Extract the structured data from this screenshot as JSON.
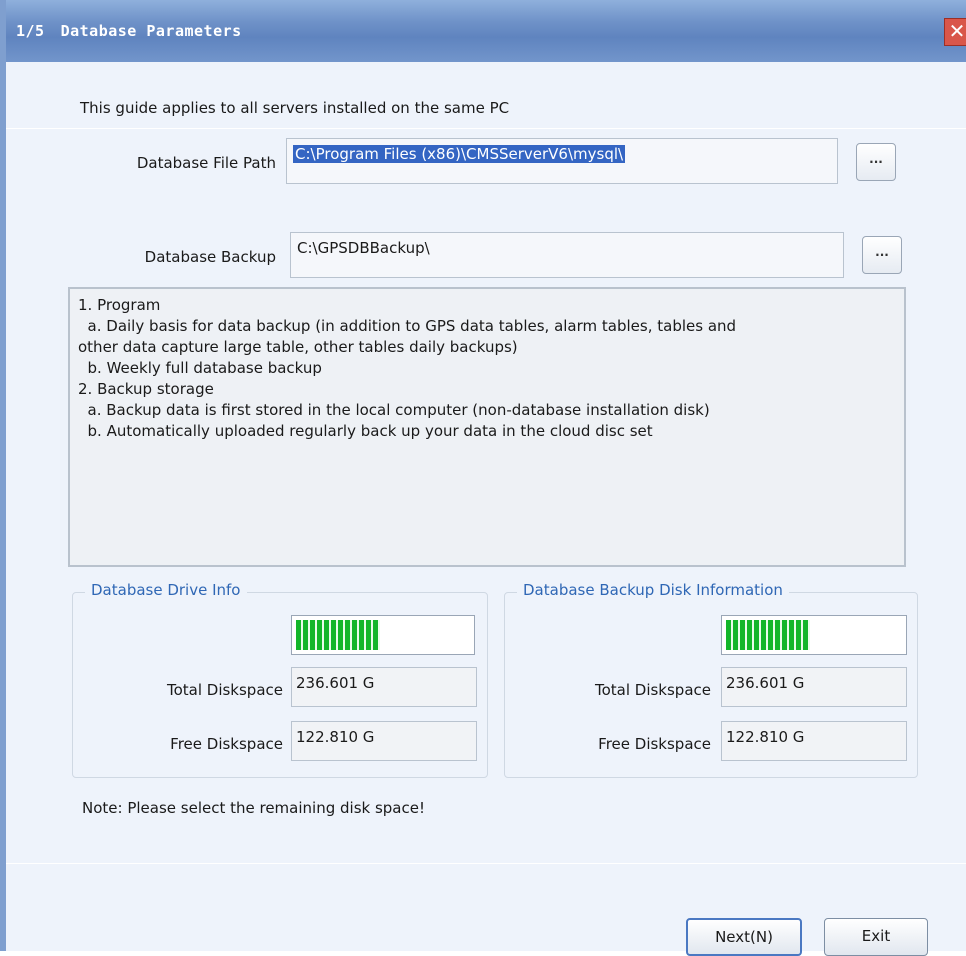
{
  "window": {
    "step": "1/5",
    "title": "Database Parameters"
  },
  "guide_text": "This guide applies to all servers installed on the same PC",
  "db_file_path": {
    "label": "Database File Path",
    "value": "C:\\Program Files (x86)\\CMSServerV6\\mysql\\",
    "browse_label": "..."
  },
  "db_backup": {
    "label": "Database Backup",
    "value": "C:\\GPSDBBackup\\",
    "browse_label": "..."
  },
  "info_lines": [
    "1. Program",
    "  a. Daily basis for data backup (in addition to GPS data tables, alarm tables, tables and",
    "other data capture large table, other tables daily backups)",
    "  b. Weekly full database backup",
    "2. Backup storage",
    "  a. Backup data is first stored in the local computer (non-database installation disk)",
    "  b. Automatically uploaded regularly back up your data in the cloud disc set"
  ],
  "drive_info": {
    "title": "Database Drive Info",
    "used_fraction": 0.48,
    "total_label": "Total Diskspace",
    "total_value": "236.601 G",
    "free_label": "Free Diskspace",
    "free_value": "122.810 G"
  },
  "backup_disk_info": {
    "title": "Database Backup Disk Information",
    "used_fraction": 0.48,
    "total_label": "Total Diskspace",
    "total_value": "236.601 G",
    "free_label": "Free Diskspace",
    "free_value": "122.810 G"
  },
  "note": "Note: Please select the remaining disk space!",
  "buttons": {
    "next": "Next(N)",
    "exit": "Exit"
  },
  "colors": {
    "titlebar": "#6f92c8",
    "group_title": "#2f67b5",
    "bar_fill": "#13b629"
  },
  "icons": {
    "close": "close-icon"
  }
}
